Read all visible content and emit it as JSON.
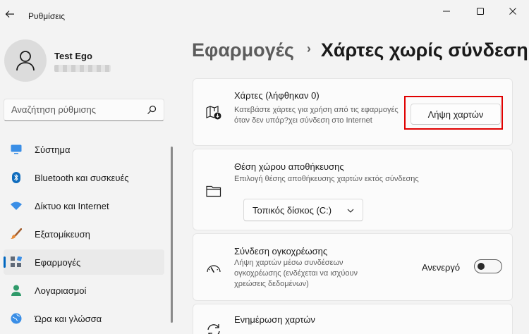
{
  "window": {
    "title": "Ρυθμίσεις"
  },
  "profile": {
    "name": "Test Ego"
  },
  "search": {
    "placeholder": "Αναζήτηση ρύθμισης"
  },
  "nav": {
    "items": [
      {
        "label": "Σύστημα",
        "icon": "monitor-icon"
      },
      {
        "label": "Bluetooth και συσκευές",
        "icon": "bluetooth-icon"
      },
      {
        "label": "Δίκτυο και Internet",
        "icon": "wifi-icon"
      },
      {
        "label": "Εξατομίκευση",
        "icon": "brush-icon"
      },
      {
        "label": "Εφαρμογές",
        "icon": "apps-icon",
        "selected": true
      },
      {
        "label": "Λογαριασμοί",
        "icon": "person-icon"
      },
      {
        "label": "Ώρα και γλώσσα",
        "icon": "globe-icon"
      }
    ]
  },
  "breadcrumb": {
    "parent": "Εφαρμογές",
    "separator": "›",
    "current": "Χάρτες χωρίς σύνδεση"
  },
  "cards": {
    "maps": {
      "title": "Χάρτες (λήφθηκαν 0)",
      "description": "Κατεβάστε χάρτες για χρήση από τις εφαρμογές όταν δεν υπάρ?χει σύνδεση στο Internet",
      "button": "Λήψη χαρτών",
      "icon": "map-download-icon"
    },
    "storage": {
      "title": "Θέση χώρου αποθήκευσης",
      "description": "Επιλογή θέσης αποθήκευσης χαρτών εκτός σύνδεσης",
      "dropdown_value": "Τοπικός δίσκος (C:)",
      "icon": "folder-icon"
    },
    "metered": {
      "title": "Σύνδεση ογκοχρέωσης",
      "description": "Λήψη χαρτών μέσω συνδέσεων ογκοχρέωσης (ενδέχεται να ισχύουν χρεώσεις δεδομένων)",
      "toggle_label": "Ανενεργό",
      "toggle_on": false,
      "icon": "gauge-icon"
    },
    "updates": {
      "title": "Ενημέρωση χαρτών",
      "icon": "refresh-icon"
    }
  },
  "colors": {
    "accent": "#0067c0",
    "highlight": "#e00000",
    "background": "#f3f3f3",
    "card": "#fbfbfb"
  }
}
